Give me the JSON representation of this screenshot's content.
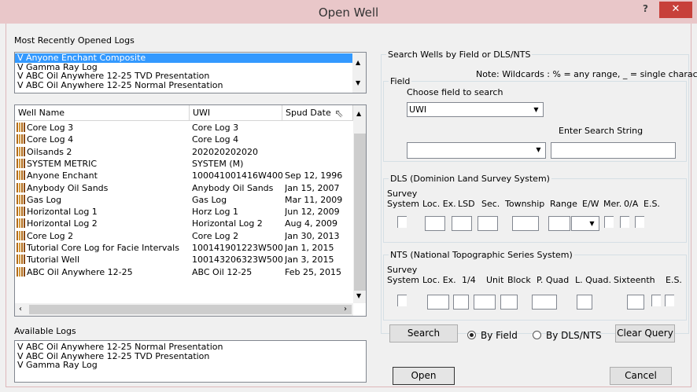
{
  "window": {
    "title": "Open Well",
    "help_label": "?",
    "close_label": "✕"
  },
  "recent": {
    "label": "Most Recently Opened Logs",
    "items": [
      "V  Anyone Enchant Composite",
      "V  Gamma Ray Log",
      "V  ABC Oil Anywhere 12-25 TVD Presentation",
      "V  ABC Oil Anywhere 12-25 Normal Presentation"
    ]
  },
  "wells": {
    "columns": [
      "Well Name",
      "UWI",
      "Spud Date"
    ],
    "rows": [
      [
        "Core Log 3",
        "Core Log 3",
        ""
      ],
      [
        "Core Log 4",
        "Core Log 4",
        ""
      ],
      [
        "Oilsands 2",
        "202020202020",
        ""
      ],
      [
        "SYSTEM METRIC",
        "SYSTEM (M)",
        ""
      ],
      [
        "Anyone Enchant",
        "100041001416W400",
        "Sep 12, 1996"
      ],
      [
        "Anybody Oil Sands",
        "Anybody Oil Sands",
        "Jan 15, 2007"
      ],
      [
        "Gas Log",
        "Gas Log",
        "Mar 11, 2009"
      ],
      [
        "Horizontal Log 1",
        "Horz Log 1",
        "Jun 12, 2009"
      ],
      [
        "Horizontal Log 2",
        "Horizontal Log 2",
        "Aug 4, 2009"
      ],
      [
        "Core Log 2",
        "Core Log 2",
        "Jan 30, 2013"
      ],
      [
        "Tutorial Core Log for Facie Intervals",
        "100141901223W500",
        "Jan 1, 2015"
      ],
      [
        "Tutorial Well",
        "100143206323W500",
        "Jan 3, 2015"
      ],
      [
        "ABC Oil Anywhere 12-25",
        "ABC Oil 12-25",
        "Feb 25, 2015"
      ]
    ]
  },
  "available": {
    "label": "Available Logs",
    "items": [
      "V  ABC Oil Anywhere 12-25 Normal Presentation",
      "V  ABC Oil Anywhere 12-25 TVD Presentation",
      "V  Gamma Ray Log"
    ]
  },
  "search_group": {
    "title": "Search Wells by Field or DLS/NTS",
    "note": "Note: Wildcards : % = any range, _ = single character",
    "field_group": "Field",
    "choose_label": "Choose field to search",
    "field_value": "UWI",
    "enter_label": "Enter Search String",
    "search_string": ""
  },
  "dls": {
    "title": "DLS (Dominion Land Survey System)",
    "survey_line1": "Survey",
    "headers": [
      "System",
      "Loc. Ex.",
      "LSD",
      "Sec.",
      "Township",
      "Range",
      "E/W",
      "Mer.",
      "0/A",
      "E.S."
    ]
  },
  "nts": {
    "title": "NTS (National Topographic Series System)",
    "survey_line1": "Survey",
    "headers": [
      "System",
      "Loc. Ex.",
      "1/4",
      "Unit",
      "Block",
      "P. Quad",
      "L. Quad.",
      "Sixteenth",
      "E.S."
    ]
  },
  "actions": {
    "search": "Search",
    "by_field": "By Field",
    "by_dls": "By DLS/NTS",
    "clear": "Clear Query",
    "open": "Open",
    "cancel": "Cancel"
  }
}
